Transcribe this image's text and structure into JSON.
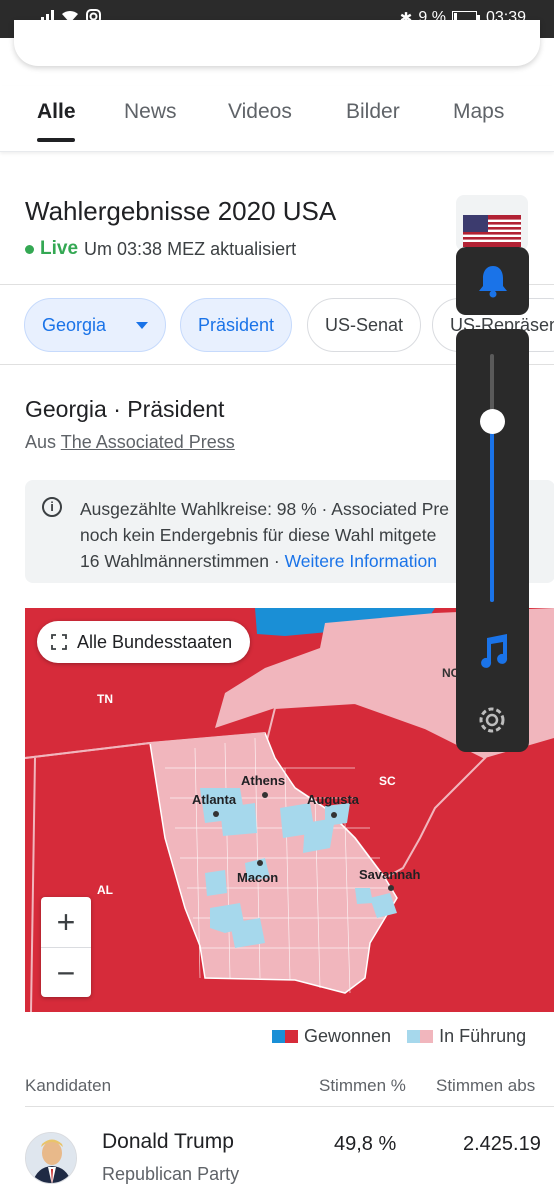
{
  "status_bar": {
    "battery": "9 %",
    "time": "03:39"
  },
  "tabs": [
    {
      "label": "Alle"
    },
    {
      "label": "News"
    },
    {
      "label": "Videos"
    },
    {
      "label": "Bilder"
    },
    {
      "label": "Maps"
    }
  ],
  "header": {
    "title": "Wahlergebnisse 2020 USA",
    "live_label": "Live",
    "updated": "Um 03:38 MEZ aktualisiert"
  },
  "chips": [
    {
      "label": "Georgia"
    },
    {
      "label": "Präsident"
    },
    {
      "label": "US-Senat"
    },
    {
      "label": "US-Repräsen"
    }
  ],
  "section": {
    "title": "Georgia · Präsident",
    "source_prefix": "Aus",
    "source_link": "The Associated Press"
  },
  "info": {
    "line1": "Ausgezählte Wahlkreise: 98 % · Associated Pre",
    "line2": "noch kein Endergebnis für diese Wahl mitgete",
    "line3_text": "16 Wahlmännerstimmen · ",
    "line3_link": "Weitere Information"
  },
  "map": {
    "all_states_button": "Alle Bundesstaaten",
    "state_labels": {
      "tn": "TN",
      "nc": "NC",
      "sc": "SC",
      "al": "AL"
    },
    "cities": {
      "athens": "Athens",
      "atlanta": "Atlanta",
      "augusta": "Augusta",
      "macon": "Macon",
      "savannah": "Savannah"
    },
    "zoom_in": "+",
    "zoom_out": "−"
  },
  "legend": {
    "won": "Gewonnen",
    "leading": "In Führung"
  },
  "table": {
    "col_candidates": "Kandidaten",
    "col_percent": "Stimmen %",
    "col_absolute": "Stimmen abs",
    "rows": [
      {
        "name": "Donald Trump",
        "party": "Republican Party",
        "percent": "49,8 %",
        "votes": "2.425.19"
      }
    ]
  },
  "colors": {
    "republican_won": "#d62b3a",
    "republican_leading": "#f1b6bd",
    "democrat_won": "#1a8fd6",
    "democrat_leading": "#a6d8ec",
    "accent": "#1a73e8"
  }
}
